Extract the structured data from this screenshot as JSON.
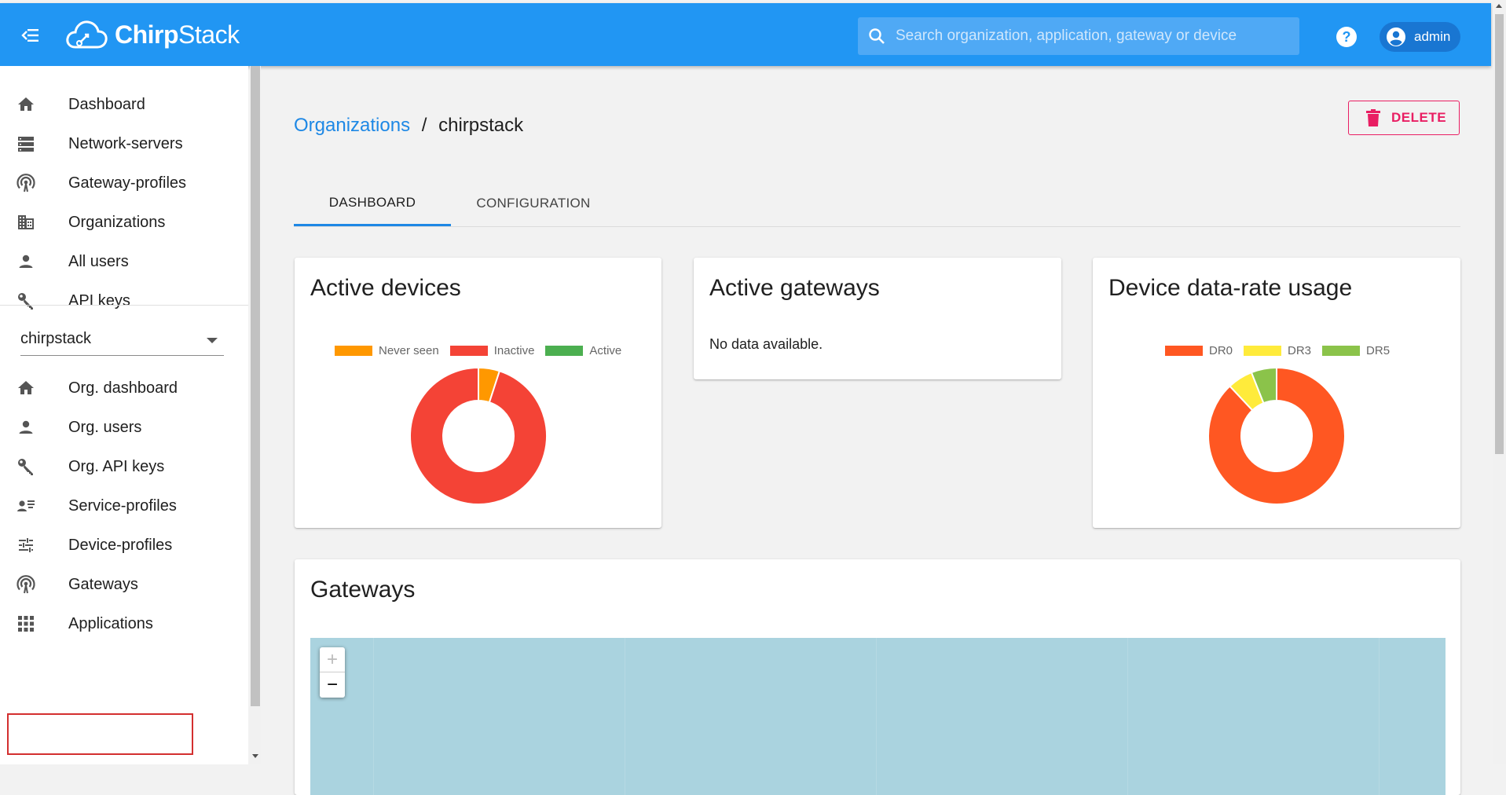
{
  "app": {
    "logo_text_bold": "Chirp",
    "logo_text": "Stack",
    "search_placeholder": "Search organization, application, gateway or device",
    "user": "admin"
  },
  "sidebar": {
    "global_items": [
      {
        "label": "Dashboard",
        "icon": "home-icon"
      },
      {
        "label": "Network-servers",
        "icon": "server-icon"
      },
      {
        "label": "Gateway-profiles",
        "icon": "radio-tower-icon"
      },
      {
        "label": "Organizations",
        "icon": "domain-icon"
      },
      {
        "label": "All users",
        "icon": "account-icon"
      },
      {
        "label": "API keys",
        "icon": "key-icon"
      }
    ],
    "org_selector": "chirpstack",
    "org_items": [
      {
        "label": "Org. dashboard",
        "icon": "home-icon"
      },
      {
        "label": "Org. users",
        "icon": "account-icon"
      },
      {
        "label": "Org. API keys",
        "icon": "key-icon"
      },
      {
        "label": "Service-profiles",
        "icon": "account-details-icon"
      },
      {
        "label": "Device-profiles",
        "icon": "tune-icon"
      },
      {
        "label": "Gateways",
        "icon": "radio-tower-icon"
      },
      {
        "label": "Applications",
        "icon": "apps-icon"
      }
    ]
  },
  "breadcrumb": {
    "link": "Organizations",
    "separator": "/",
    "current": "chirpstack"
  },
  "actions": {
    "delete_label": "DELETE"
  },
  "tabs": [
    "DASHBOARD",
    "CONFIGURATION"
  ],
  "cards": {
    "active_devices": {
      "title": "Active devices",
      "legend": [
        "Never seen",
        "Inactive",
        "Active"
      ]
    },
    "active_gateways": {
      "title": "Active gateways",
      "empty_text": "No data available."
    },
    "data_rate": {
      "title": "Device data-rate usage",
      "legend": [
        "DR0",
        "DR3",
        "DR5"
      ]
    },
    "gateways": {
      "title": "Gateways",
      "zoom_in": "+",
      "zoom_out": "−"
    }
  },
  "colors": {
    "primary": "#2196f3",
    "accent_link": "#1e88e5",
    "delete": "#e91e63",
    "never_seen": "#ff9800",
    "inactive": "#f44336",
    "active": "#4caf50",
    "dr0": "#ff5722",
    "dr3": "#ffeb3b",
    "dr5": "#8bc34a",
    "map_water": "#aad3df"
  },
  "chart_data": [
    {
      "type": "pie",
      "categories": [
        "Never seen",
        "Inactive",
        "Active"
      ],
      "values": [
        5,
        95,
        0
      ]
    },
    {
      "type": "pie",
      "categories": [
        "DR0",
        "DR3",
        "DR5"
      ],
      "values": [
        88,
        6,
        6
      ]
    }
  ]
}
